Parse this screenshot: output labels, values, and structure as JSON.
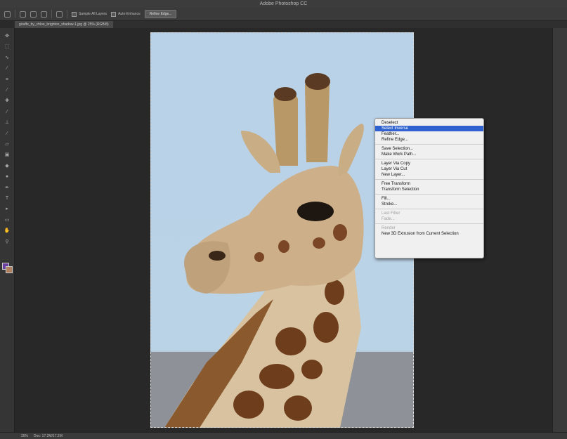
{
  "app": {
    "title": "Adobe Photoshop CC"
  },
  "options_bar": {
    "sample_all_layers": "Sample All Layers",
    "auto_enhance": "Auto-Enhance",
    "refine_edge": "Refine Edge..."
  },
  "document": {
    "tab_label": "giraffe_by_chloe_brighton_shadow-1.jpg @ 25% (RGB/8)"
  },
  "status_bar": {
    "zoom": "25%",
    "doc_info": "Doc: 17.2M/17.2M"
  },
  "context_menu": {
    "items": [
      {
        "label": "Deselect",
        "state": "normal"
      },
      {
        "label": "Select Inverse",
        "state": "active"
      },
      {
        "label": "Feather...",
        "state": "normal"
      },
      {
        "label": "Refine Edge...",
        "state": "normal"
      },
      {
        "sep": true
      },
      {
        "label": "Save Selection...",
        "state": "normal"
      },
      {
        "label": "Make Work Path...",
        "state": "normal"
      },
      {
        "sep": true
      },
      {
        "label": "Layer Via Copy",
        "state": "normal"
      },
      {
        "label": "Layer Via Cut",
        "state": "normal"
      },
      {
        "label": "New Layer...",
        "state": "normal"
      },
      {
        "sep": true
      },
      {
        "label": "Free Transform",
        "state": "normal"
      },
      {
        "label": "Transform Selection",
        "state": "normal"
      },
      {
        "sep": true
      },
      {
        "label": "Fill...",
        "state": "normal"
      },
      {
        "label": "Stroke...",
        "state": "normal"
      },
      {
        "sep": true
      },
      {
        "label": "Last Filter",
        "state": "disabled"
      },
      {
        "label": "Fade...",
        "state": "disabled"
      },
      {
        "sep": true
      },
      {
        "label": "Render",
        "state": "disabled"
      },
      {
        "label": "New 3D Extrusion from Current Selection",
        "state": "normal"
      }
    ]
  },
  "colors": {
    "foreground": "#6b3fa0",
    "background": "#b08060",
    "menu_highlight": "#2f62d0"
  },
  "tools": [
    {
      "name": "move-tool-icon",
      "glyph": "✥"
    },
    {
      "name": "marquee-tool-icon",
      "glyph": "⬚"
    },
    {
      "name": "lasso-tool-icon",
      "glyph": "∿"
    },
    {
      "name": "quick-selection-tool-icon",
      "glyph": "⁄"
    },
    {
      "name": "crop-tool-icon",
      "glyph": "⌗"
    },
    {
      "name": "eyedropper-tool-icon",
      "glyph": "⁄"
    },
    {
      "name": "healing-brush-tool-icon",
      "glyph": "✚"
    },
    {
      "name": "brush-tool-icon",
      "glyph": "⁄"
    },
    {
      "name": "clone-stamp-tool-icon",
      "glyph": "⊥"
    },
    {
      "name": "history-brush-tool-icon",
      "glyph": "⁄"
    },
    {
      "name": "eraser-tool-icon",
      "glyph": "▱"
    },
    {
      "name": "gradient-tool-icon",
      "glyph": "▣"
    },
    {
      "name": "blur-tool-icon",
      "glyph": "◆"
    },
    {
      "name": "dodge-tool-icon",
      "glyph": "●"
    },
    {
      "name": "pen-tool-icon",
      "glyph": "✒"
    },
    {
      "name": "type-tool-icon",
      "glyph": "T"
    },
    {
      "name": "path-selection-tool-icon",
      "glyph": "▸"
    },
    {
      "name": "shape-tool-icon",
      "glyph": "▭"
    },
    {
      "name": "hand-tool-icon",
      "glyph": "✋"
    },
    {
      "name": "zoom-tool-icon",
      "glyph": "⚲"
    }
  ]
}
